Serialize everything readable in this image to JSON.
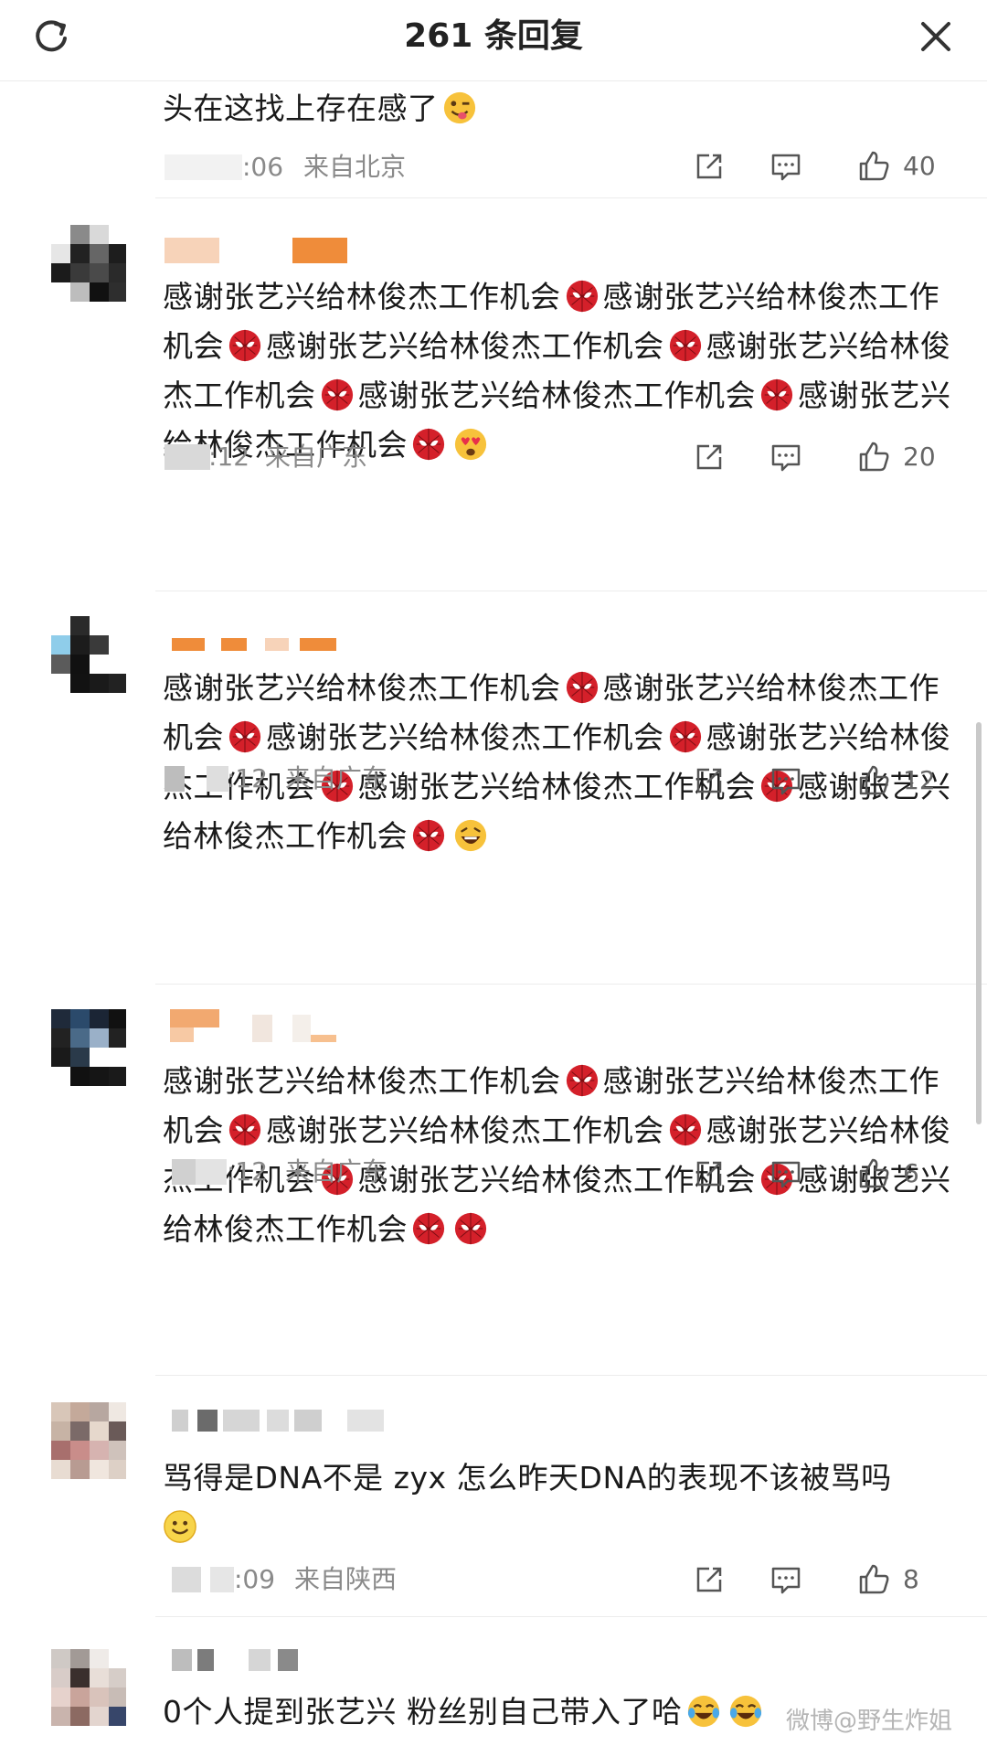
{
  "header": {
    "title": "261 条回复"
  },
  "comments": [
    {
      "text": "头在这找上存在感了",
      "time": ":06",
      "location": "来自北京",
      "likes": "40"
    },
    {
      "text": "感谢张艺兴给林俊杰工作机会",
      "time": ":12",
      "location": "来自广东",
      "likes": "20"
    },
    {
      "text": "感谢张艺兴给林俊杰工作机会",
      "time": ":12",
      "location": "来自广东",
      "likes": "12"
    },
    {
      "text": "感谢张艺兴给林俊杰工作机会",
      "time": ":12",
      "location": "来自广东",
      "likes": "6"
    },
    {
      "text": "骂得是DNA不是 zyx 怎么昨天DNA的表现不该被骂吗",
      "time": ":09",
      "location": "来自陕西",
      "likes": "8"
    },
    {
      "text": "0个人提到张艺兴 粉丝别自己带入了哈"
    }
  ],
  "watermark": "微博@野生炸姐",
  "icons": {
    "refresh": "refresh-icon",
    "close": "close-icon",
    "share": "share-icon",
    "comment": "comment-icon",
    "like": "thumbs-up-icon",
    "emoji_tongue": "tongue-emoji-icon",
    "emoji_spider": "spider-mask-emoji-icon",
    "emoji_heart_eyes": "heart-eyes-emoji-icon",
    "emoji_laugh": "laughing-emoji-icon",
    "emoji_smile": "smile-emoji-icon",
    "emoji_cry_laugh": "tears-of-joy-emoji-icon"
  },
  "colors": {
    "text": "#1a1a1a",
    "meta": "#8a8a8a",
    "divider": "#ececec",
    "accent": "#e98a3a"
  }
}
